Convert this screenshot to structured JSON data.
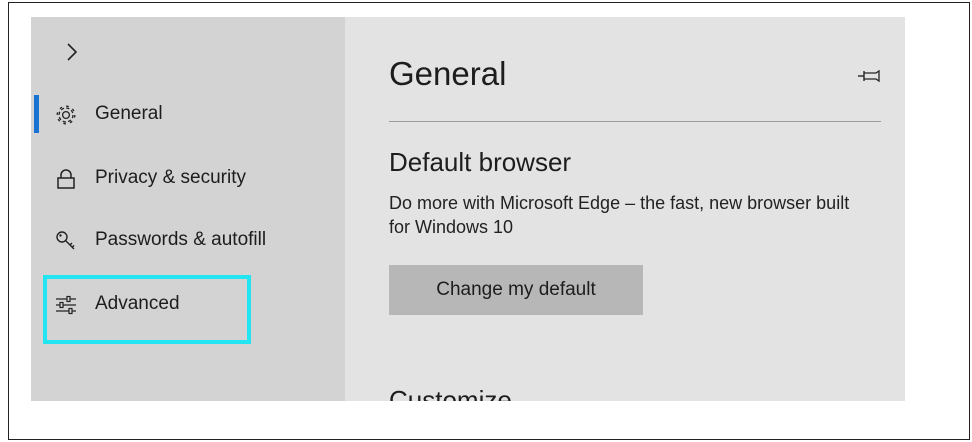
{
  "sidebar": {
    "expand_icon": "chevron-right-icon",
    "active_indicator_color": "#1a73d2",
    "items": [
      {
        "label": "General",
        "icon": "gear-icon",
        "active": true
      },
      {
        "label": "Privacy & security",
        "icon": "lock-icon",
        "active": false
      },
      {
        "label": "Passwords & autofill",
        "icon": "key-icon",
        "active": false
      },
      {
        "label": "Advanced",
        "icon": "sliders-icon",
        "active": false
      }
    ]
  },
  "annotation": {
    "highlight_color": "#22e5f1",
    "target": "Advanced"
  },
  "main": {
    "title": "General",
    "pin_icon": "pin-icon",
    "default_browser": {
      "heading": "Default browser",
      "description": "Do more with Microsoft Edge – the fast, new browser built for Windows 10",
      "button_label": "Change my default"
    },
    "next_section_heading": "Customize"
  }
}
